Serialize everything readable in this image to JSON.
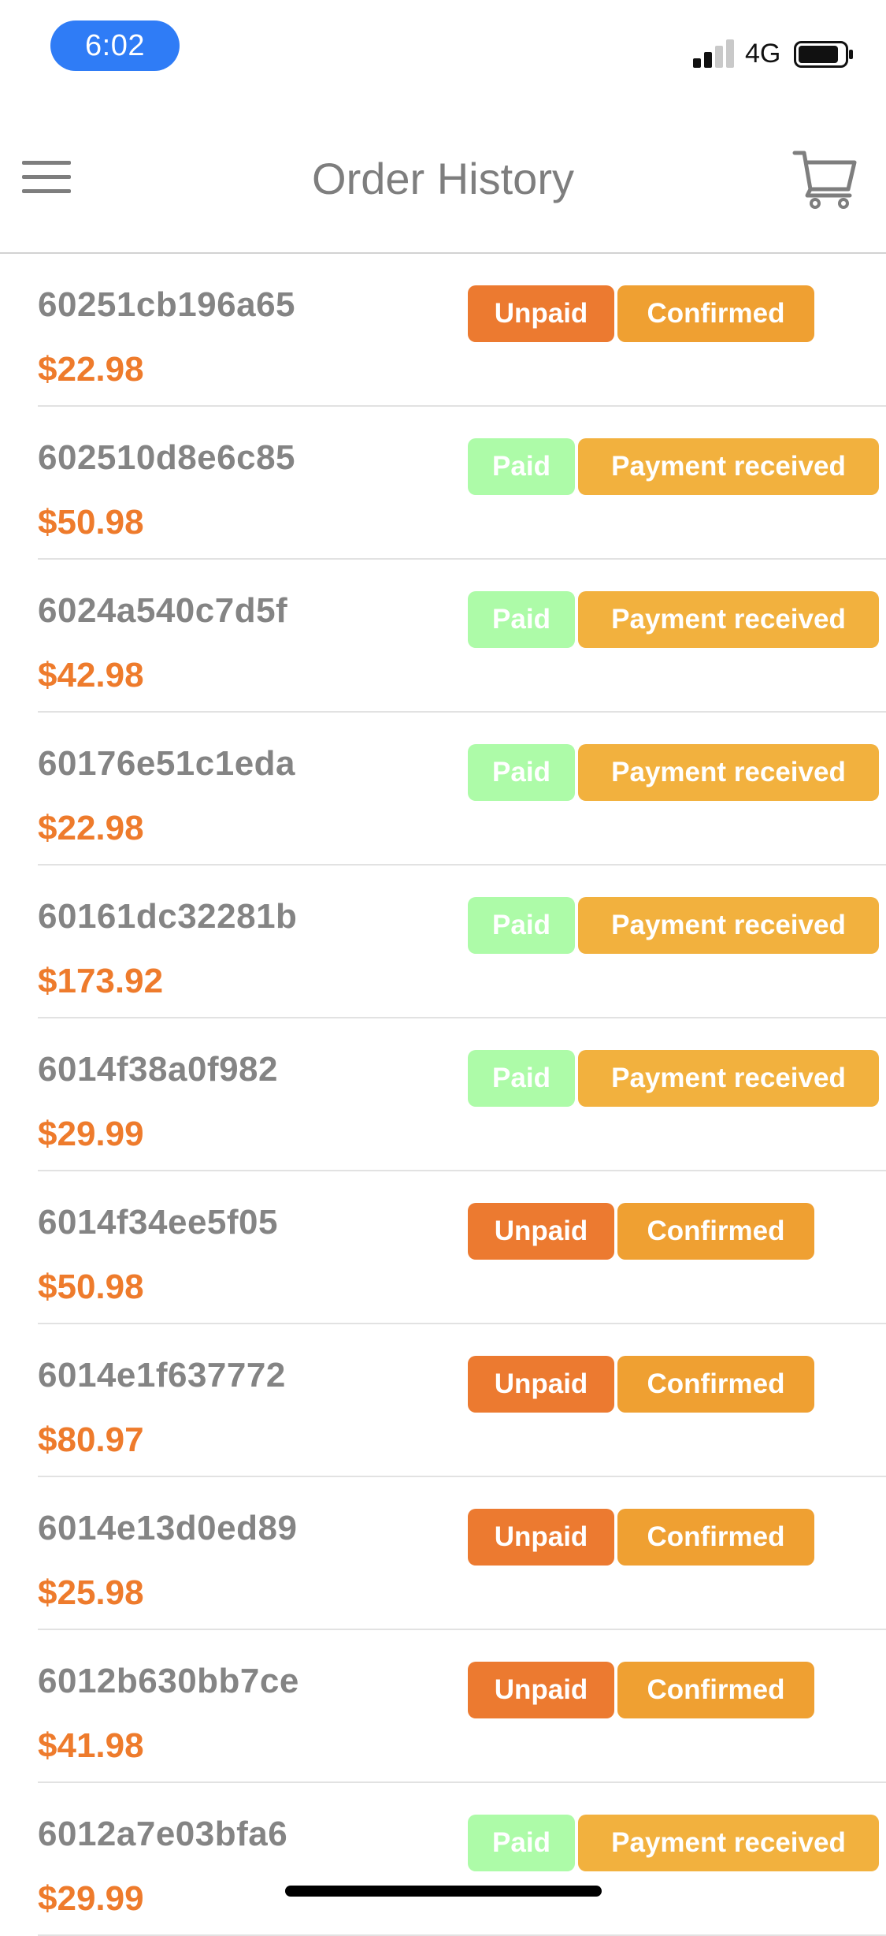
{
  "status_bar": {
    "time": "6:02",
    "network": "4G",
    "signal_icon": "signal-bars-icon",
    "battery_icon": "battery-icon"
  },
  "nav": {
    "title": "Order History",
    "menu_icon": "hamburger-menu-icon",
    "cart_icon": "shopping-cart-icon"
  },
  "colors": {
    "accent_orange": "#ee7b2c",
    "unpaid_badge": "#ec7a30",
    "paid_badge": "#adfba8",
    "confirmed_badge": "#efa032",
    "received_badge": "#f2b13e",
    "time_pill": "#2f7cf6"
  },
  "orders": [
    {
      "id": "60251cb196a65",
      "total": "$22.98",
      "payment": "Unpaid",
      "payment_type": "unpaid",
      "status": "Confirmed",
      "status_type": "confirmed"
    },
    {
      "id": "602510d8e6c85",
      "total": "$50.98",
      "payment": "Paid",
      "payment_type": "paid",
      "status": "Payment received",
      "status_type": "received"
    },
    {
      "id": "6024a540c7d5f",
      "total": "$42.98",
      "payment": "Paid",
      "payment_type": "paid",
      "status": "Payment received",
      "status_type": "received"
    },
    {
      "id": "60176e51c1eda",
      "total": "$22.98",
      "payment": "Paid",
      "payment_type": "paid",
      "status": "Payment received",
      "status_type": "received"
    },
    {
      "id": "60161dc32281b",
      "total": "$173.92",
      "payment": "Paid",
      "payment_type": "paid",
      "status": "Payment received",
      "status_type": "received"
    },
    {
      "id": "6014f38a0f982",
      "total": "$29.99",
      "payment": "Paid",
      "payment_type": "paid",
      "status": "Payment received",
      "status_type": "received"
    },
    {
      "id": "6014f34ee5f05",
      "total": "$50.98",
      "payment": "Unpaid",
      "payment_type": "unpaid",
      "status": "Confirmed",
      "status_type": "confirmed"
    },
    {
      "id": "6014e1f637772",
      "total": "$80.97",
      "payment": "Unpaid",
      "payment_type": "unpaid",
      "status": "Confirmed",
      "status_type": "confirmed"
    },
    {
      "id": "6014e13d0ed89",
      "total": "$25.98",
      "payment": "Unpaid",
      "payment_type": "unpaid",
      "status": "Confirmed",
      "status_type": "confirmed"
    },
    {
      "id": "6012b630bb7ce",
      "total": "$41.98",
      "payment": "Unpaid",
      "payment_type": "unpaid",
      "status": "Confirmed",
      "status_type": "confirmed"
    },
    {
      "id": "6012a7e03bfa6",
      "total": "$29.99",
      "payment": "Paid",
      "payment_type": "paid",
      "status": "Payment received",
      "status_type": "received"
    }
  ]
}
